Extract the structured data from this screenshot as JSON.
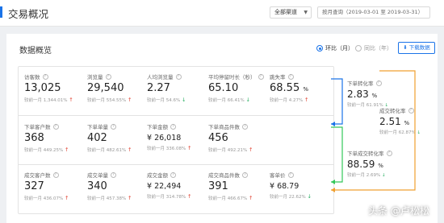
{
  "header": {
    "title": "交易概况",
    "channel_select": "全部渠道",
    "date_range": "按月查询（2019-03-01 至 2019-03-31）"
  },
  "panel": {
    "title": "数据概览",
    "toggle_mom": "环比（月）",
    "toggle_yoy": "同比（年）",
    "download": "下载数据"
  },
  "metrics": [
    {
      "label": "访客数",
      "value": "13,025",
      "unit": "",
      "cmp_label": "较前一月",
      "cmp_value": "1,344.01%",
      "trend": "up"
    },
    {
      "label": "浏览量",
      "value": "29,540",
      "unit": "",
      "cmp_label": "较前一月",
      "cmp_value": "554.55%",
      "trend": "up"
    },
    {
      "label": "人均浏览量",
      "value": "2.27",
      "unit": "",
      "cmp_label": "较前一月",
      "cmp_value": "54.6%",
      "trend": "down"
    },
    {
      "label": "平均停留时长（秒）",
      "value": "65.10",
      "unit": "",
      "cmp_label": "较前一月",
      "cmp_value": "66.41%",
      "trend": "down"
    },
    {
      "label": "跳失率",
      "value": "68.55",
      "unit": "%",
      "cmp_label": "较前一月",
      "cmp_value": "4.27%",
      "trend": "up"
    },
    {
      "label": "下单客户数",
      "value": "368",
      "unit": "",
      "cmp_label": "较前一月",
      "cmp_value": "449.25%",
      "trend": "up"
    },
    {
      "label": "下单单量",
      "value": "402",
      "unit": "",
      "cmp_label": "较前一月",
      "cmp_value": "482.61%",
      "trend": "up"
    },
    {
      "label": "下单金额",
      "value": "¥ 26,018",
      "unit": "",
      "cmp_label": "较前一月",
      "cmp_value": "336.08%",
      "trend": "up"
    },
    {
      "label": "下单商品件数",
      "value": "456",
      "unit": "",
      "cmp_label": "较前一月",
      "cmp_value": "492.21%",
      "trend": "up"
    },
    {
      "label": "成交客户数",
      "value": "327",
      "unit": "",
      "cmp_label": "较前一月",
      "cmp_value": "436.07%",
      "trend": "up"
    },
    {
      "label": "成交单量",
      "value": "340",
      "unit": "",
      "cmp_label": "较前一月",
      "cmp_value": "457.38%",
      "trend": "up"
    },
    {
      "label": "成交金额",
      "value": "¥ 22,494",
      "unit": "",
      "cmp_label": "较前一月",
      "cmp_value": "314.78%",
      "trend": "up"
    },
    {
      "label": "成交商品件数",
      "value": "391",
      "unit": "",
      "cmp_label": "较前一月",
      "cmp_value": "466.67%",
      "trend": "up"
    },
    {
      "label": "客单价",
      "value": "¥ 68.79",
      "unit": "",
      "cmp_label": "较前一月",
      "cmp_value": "22.62%",
      "trend": "down"
    }
  ],
  "rates": [
    {
      "label": "下单转化率",
      "value": "2.83",
      "unit": "%",
      "cmp_label": "较前一月",
      "cmp_value": "61.91%",
      "trend": "down"
    },
    {
      "label": "成交转化率",
      "value": "2.51",
      "unit": "%",
      "cmp_label": "较前一月",
      "cmp_value": "62.87%",
      "trend": "down"
    },
    {
      "label": "下单成交转化率",
      "value": "88.59",
      "unit": "%",
      "cmp_label": "较前一月",
      "cmp_value": "2.69%",
      "trend": "down"
    }
  ],
  "watermark": "头条 @卢松松",
  "colors": {
    "accent": "#1a73e8",
    "up": "#e03e2d",
    "down": "#27ae60",
    "flow_blue": "#1a73e8",
    "flow_green": "#34c759",
    "flow_orange": "#f0a030"
  }
}
